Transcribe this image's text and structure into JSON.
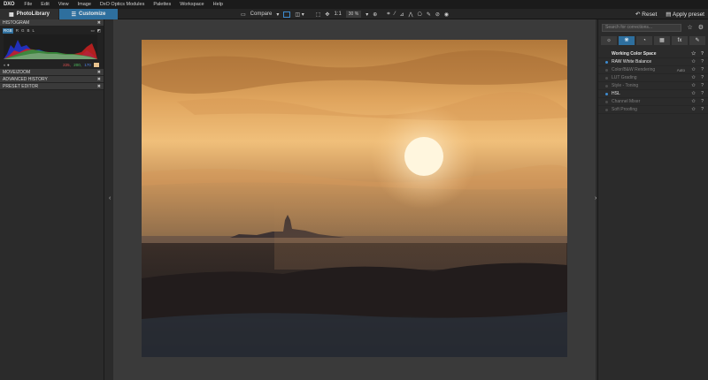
{
  "app": {
    "logo": "DXO",
    "menu": [
      "File",
      "Edit",
      "View",
      "Image",
      "DxO Optics Modules",
      "Palettes",
      "Workspace",
      "Help"
    ]
  },
  "toolbar": {
    "tab_library": "PhotoLibrary",
    "tab_customize": "Customize",
    "compare_label": "Compare",
    "one_to_one": "1:1",
    "zoom_value": "30 %",
    "reset_label": "Reset",
    "apply_preset_label": "Apply preset"
  },
  "left_panel": {
    "histogram": {
      "title": "HISTOGRAM",
      "channels": [
        "RGB",
        "R",
        "G",
        "B",
        "L"
      ],
      "active_channel": "RGB",
      "r_value": "225,",
      "g_value": "200,",
      "b_value": "170",
      "swatch_color": "#e8c28e"
    },
    "sections": [
      "MOVE/ZOOM",
      "ADVANCED HISTORY",
      "PRESET EDITOR"
    ]
  },
  "right_panel": {
    "search_placeholder": "Search for corrections...",
    "categories": [
      "sun-icon",
      "color-icon",
      "detail-icon",
      "geometry-icon",
      "fx",
      "local-icon"
    ],
    "active_category": 1,
    "items": [
      {
        "label": "Working Color Space",
        "type": "header"
      },
      {
        "label": "RAW White Balance",
        "active": true
      },
      {
        "label": "Color/B&W Rendering",
        "active": false,
        "option": "Auto"
      },
      {
        "label": "LUT Grading",
        "active": false
      },
      {
        "label": "Style - Toning",
        "active": false
      },
      {
        "label": "HSL",
        "active": true
      },
      {
        "label": "Channel Mixer",
        "active": false
      },
      {
        "label": "Soft Proofing",
        "active": false
      }
    ]
  },
  "colors": {
    "accent": "#2e6f9e",
    "sky_top": "#b57a3a",
    "sun": "#fff6de",
    "sea": "#1e1c1e"
  }
}
